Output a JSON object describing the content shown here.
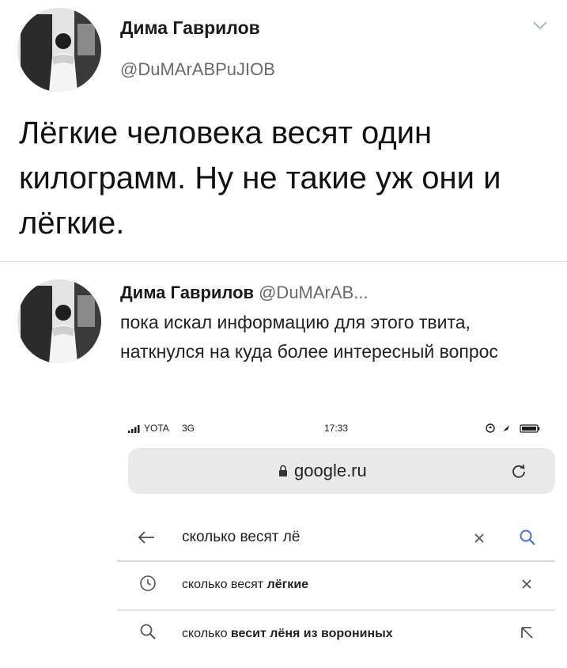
{
  "tweet": {
    "author": {
      "name": "Дима Гаврилов",
      "handle": "@DuMArABPuJIOB"
    },
    "text": "Лёгкие человека весят один килограмм. Ну не такие уж они и лёгкие."
  },
  "quoted": {
    "name": "Дима Гаврилов",
    "handle": "@DuMArAB...",
    "text": "пока искал информацию для этого твита, наткнулся на куда более интересный вопрос"
  },
  "screenshot": {
    "status_bar": {
      "carrier": "YOTA",
      "network": "3G",
      "time": "17:33"
    },
    "url": "google.ru",
    "search": {
      "query": "сколько весят лё"
    },
    "suggestions": [
      {
        "prefix": "сколько весят ",
        "bold": "лёгкие",
        "suffix": "",
        "icon": "history-clock-icon",
        "action": "remove-x-icon"
      },
      {
        "prefix": "сколько ",
        "bold": "весит лёня из ворониных",
        "suffix": "",
        "icon": "search-icon",
        "action": "fill-arrow-icon"
      }
    ]
  },
  "icons": {
    "dropdown": "chevron-down-icon",
    "lock": "lock-icon",
    "reload": "reload-icon",
    "back": "back-arrow-icon",
    "clear": "close-icon",
    "search": "search-icon"
  },
  "colors": {
    "text": "#141414",
    "secondary": "#6a6a6a",
    "url_bar": "#e9e9ea",
    "divider": "#e6e6e6"
  }
}
